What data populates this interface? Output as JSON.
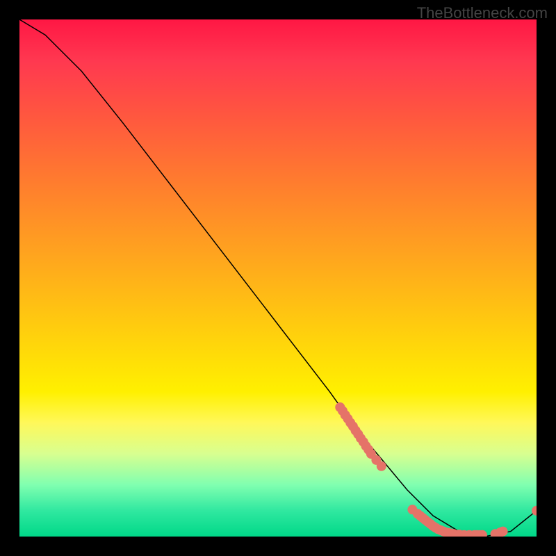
{
  "watermark": "TheBottleneck.com",
  "chart_data": {
    "type": "line",
    "title": "",
    "xlabel": "",
    "ylabel": "",
    "xlim": [
      0,
      100
    ],
    "ylim": [
      0,
      100
    ],
    "line": {
      "x": [
        0,
        5,
        8,
        12,
        20,
        30,
        40,
        50,
        60,
        65,
        70,
        75,
        80,
        85,
        90,
        95,
        100
      ],
      "y": [
        100,
        97,
        94,
        90,
        80,
        67,
        54,
        41,
        28,
        21,
        15,
        9,
        4,
        1,
        0,
        1,
        5
      ]
    },
    "dots": {
      "x": [
        62,
        62.5,
        63,
        63.5,
        64,
        64.5,
        65,
        65.5,
        66,
        66.5,
        67,
        67.5,
        68,
        69,
        70,
        76,
        77,
        77.5,
        78,
        78.5,
        79,
        79.5,
        80,
        80.5,
        81,
        81.5,
        82,
        82.5,
        83,
        83.5,
        84,
        85,
        86,
        87,
        88,
        88.5,
        89,
        89.5,
        92,
        93,
        93.5,
        100
      ],
      "y": [
        25,
        24.3,
        23.5,
        22.8,
        22,
        21.3,
        20.5,
        19.8,
        19,
        18.3,
        17.5,
        16.8,
        16,
        14.8,
        13.6,
        5.2,
        4.4,
        4,
        3.6,
        3.2,
        2.8,
        2.4,
        2,
        1.7,
        1.4,
        1.2,
        1,
        0.8,
        0.7,
        0.6,
        0.5,
        0.4,
        0.3,
        0.3,
        0.3,
        0.3,
        0.3,
        0.3,
        0.5,
        0.8,
        1,
        5
      ]
    }
  }
}
